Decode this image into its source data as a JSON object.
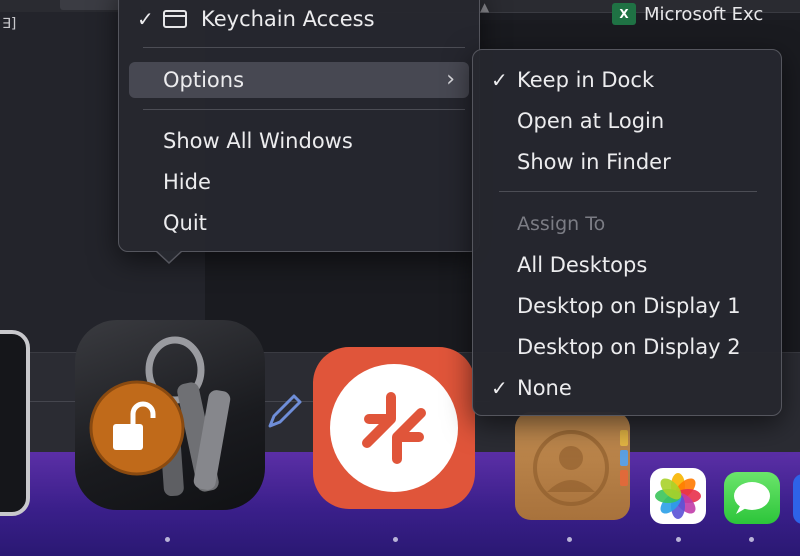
{
  "app_menu": {
    "items": [
      {
        "label": "Keychain Access",
        "checked": true,
        "icon": "window-icon"
      },
      {
        "label": "Options",
        "submenu": true,
        "highlighted": true
      },
      {
        "label": "Show All Windows"
      },
      {
        "label": "Hide"
      },
      {
        "label": "Quit"
      }
    ],
    "check_glyph": "✓",
    "chevron_glyph": "›"
  },
  "options_menu": {
    "items": [
      {
        "label": "Keep in Dock",
        "checked": true
      },
      {
        "label": "Open at Login"
      },
      {
        "label": "Show in Finder"
      }
    ],
    "assign_header": "Assign To",
    "assign_items": [
      {
        "label": "All Desktops"
      },
      {
        "label": "Desktop on Display 1"
      },
      {
        "label": "Desktop on Display 2"
      },
      {
        "label": "None",
        "checked": true
      }
    ]
  },
  "background": {
    "left_bracket": "∃]",
    "excel_title": "Microsoft Exc",
    "excel_badge": "X"
  },
  "dock": {
    "apps": [
      "Keychain Access",
      "Microsoft Remote Desktop",
      "Contacts",
      "Photos",
      "Messages"
    ],
    "colors": {
      "dock_top": "#5b2fa6",
      "dock_bottom": "#2a1873",
      "remote_desktop": "#e0553a",
      "messages": "#2cc53a",
      "contacts": "#b07a42"
    }
  }
}
